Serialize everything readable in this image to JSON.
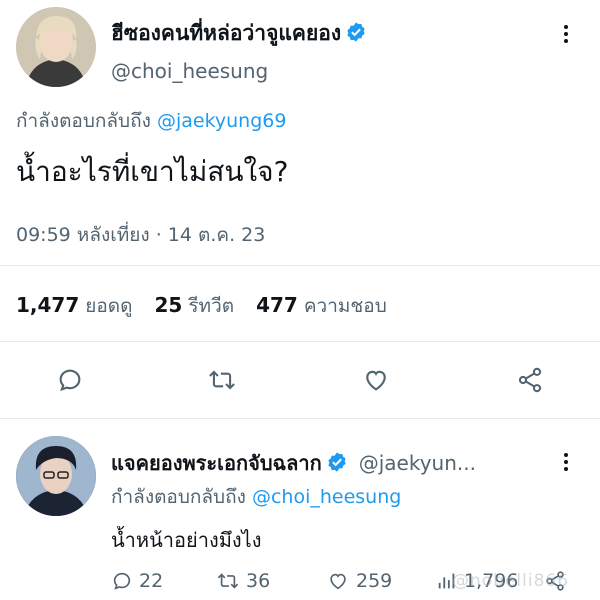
{
  "main_tweet": {
    "display_name": "ฮีซองคนที่หล่อว่าจูแคยอง",
    "handle": "@choi_heesung",
    "replying_prefix": "กำลังตอบกลับถึง",
    "replying_to": "@jaekyung69",
    "text": "น้ำอะไรที่เขาไม่สนใจ?",
    "timestamp": "09:59 หลังเที่ยง · 14 ต.ค. 23",
    "stats": {
      "views_count": "1,477",
      "views_label": "ยอดดู",
      "retweets_count": "25",
      "retweets_label": "รีทวีต",
      "likes_count": "477",
      "likes_label": "ความชอบ"
    }
  },
  "reply_tweet": {
    "display_name": "แจคยองพระเอกจับฉลาก",
    "handle": "@jaekyun...",
    "replying_prefix": "กำลังตอบกลับถึง",
    "replying_to": "@choi_heesung",
    "text": "น้ำหน้าอย่างมึงไง",
    "actions": {
      "replies": "22",
      "retweets": "36",
      "likes": "259",
      "views": "1,796"
    }
  },
  "watermark": "@nobelli866",
  "colors": {
    "accent": "#1d9bf0",
    "text": "#0f1419",
    "secondary": "#536471",
    "divider": "#e6e9eb"
  },
  "icons": [
    "verified-badge-icon",
    "more-options-icon",
    "reply-icon",
    "retweet-icon",
    "like-icon",
    "share-icon",
    "views-icon"
  ]
}
